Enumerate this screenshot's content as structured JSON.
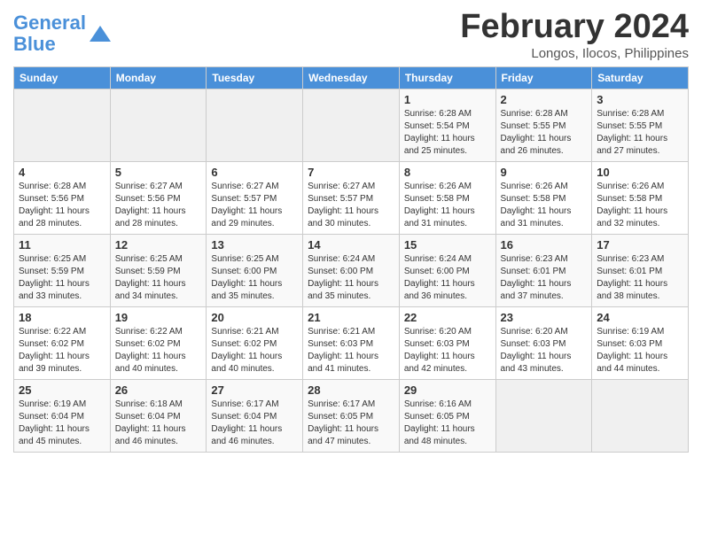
{
  "logo": {
    "line1": "General",
    "line2": "Blue"
  },
  "title": "February 2024",
  "subtitle": "Longos, Ilocos, Philippines",
  "days_of_week": [
    "Sunday",
    "Monday",
    "Tuesday",
    "Wednesday",
    "Thursday",
    "Friday",
    "Saturday"
  ],
  "weeks": [
    [
      {
        "day": "",
        "info": ""
      },
      {
        "day": "",
        "info": ""
      },
      {
        "day": "",
        "info": ""
      },
      {
        "day": "",
        "info": ""
      },
      {
        "day": "1",
        "info": "Sunrise: 6:28 AM\nSunset: 5:54 PM\nDaylight: 11 hours\nand 25 minutes."
      },
      {
        "day": "2",
        "info": "Sunrise: 6:28 AM\nSunset: 5:55 PM\nDaylight: 11 hours\nand 26 minutes."
      },
      {
        "day": "3",
        "info": "Sunrise: 6:28 AM\nSunset: 5:55 PM\nDaylight: 11 hours\nand 27 minutes."
      }
    ],
    [
      {
        "day": "4",
        "info": "Sunrise: 6:28 AM\nSunset: 5:56 PM\nDaylight: 11 hours\nand 28 minutes."
      },
      {
        "day": "5",
        "info": "Sunrise: 6:27 AM\nSunset: 5:56 PM\nDaylight: 11 hours\nand 28 minutes."
      },
      {
        "day": "6",
        "info": "Sunrise: 6:27 AM\nSunset: 5:57 PM\nDaylight: 11 hours\nand 29 minutes."
      },
      {
        "day": "7",
        "info": "Sunrise: 6:27 AM\nSunset: 5:57 PM\nDaylight: 11 hours\nand 30 minutes."
      },
      {
        "day": "8",
        "info": "Sunrise: 6:26 AM\nSunset: 5:58 PM\nDaylight: 11 hours\nand 31 minutes."
      },
      {
        "day": "9",
        "info": "Sunrise: 6:26 AM\nSunset: 5:58 PM\nDaylight: 11 hours\nand 31 minutes."
      },
      {
        "day": "10",
        "info": "Sunrise: 6:26 AM\nSunset: 5:58 PM\nDaylight: 11 hours\nand 32 minutes."
      }
    ],
    [
      {
        "day": "11",
        "info": "Sunrise: 6:25 AM\nSunset: 5:59 PM\nDaylight: 11 hours\nand 33 minutes."
      },
      {
        "day": "12",
        "info": "Sunrise: 6:25 AM\nSunset: 5:59 PM\nDaylight: 11 hours\nand 34 minutes."
      },
      {
        "day": "13",
        "info": "Sunrise: 6:25 AM\nSunset: 6:00 PM\nDaylight: 11 hours\nand 35 minutes."
      },
      {
        "day": "14",
        "info": "Sunrise: 6:24 AM\nSunset: 6:00 PM\nDaylight: 11 hours\nand 35 minutes."
      },
      {
        "day": "15",
        "info": "Sunrise: 6:24 AM\nSunset: 6:00 PM\nDaylight: 11 hours\nand 36 minutes."
      },
      {
        "day": "16",
        "info": "Sunrise: 6:23 AM\nSunset: 6:01 PM\nDaylight: 11 hours\nand 37 minutes."
      },
      {
        "day": "17",
        "info": "Sunrise: 6:23 AM\nSunset: 6:01 PM\nDaylight: 11 hours\nand 38 minutes."
      }
    ],
    [
      {
        "day": "18",
        "info": "Sunrise: 6:22 AM\nSunset: 6:02 PM\nDaylight: 11 hours\nand 39 minutes."
      },
      {
        "day": "19",
        "info": "Sunrise: 6:22 AM\nSunset: 6:02 PM\nDaylight: 11 hours\nand 40 minutes."
      },
      {
        "day": "20",
        "info": "Sunrise: 6:21 AM\nSunset: 6:02 PM\nDaylight: 11 hours\nand 40 minutes."
      },
      {
        "day": "21",
        "info": "Sunrise: 6:21 AM\nSunset: 6:03 PM\nDaylight: 11 hours\nand 41 minutes."
      },
      {
        "day": "22",
        "info": "Sunrise: 6:20 AM\nSunset: 6:03 PM\nDaylight: 11 hours\nand 42 minutes."
      },
      {
        "day": "23",
        "info": "Sunrise: 6:20 AM\nSunset: 6:03 PM\nDaylight: 11 hours\nand 43 minutes."
      },
      {
        "day": "24",
        "info": "Sunrise: 6:19 AM\nSunset: 6:03 PM\nDaylight: 11 hours\nand 44 minutes."
      }
    ],
    [
      {
        "day": "25",
        "info": "Sunrise: 6:19 AM\nSunset: 6:04 PM\nDaylight: 11 hours\nand 45 minutes."
      },
      {
        "day": "26",
        "info": "Sunrise: 6:18 AM\nSunset: 6:04 PM\nDaylight: 11 hours\nand 46 minutes."
      },
      {
        "day": "27",
        "info": "Sunrise: 6:17 AM\nSunset: 6:04 PM\nDaylight: 11 hours\nand 46 minutes."
      },
      {
        "day": "28",
        "info": "Sunrise: 6:17 AM\nSunset: 6:05 PM\nDaylight: 11 hours\nand 47 minutes."
      },
      {
        "day": "29",
        "info": "Sunrise: 6:16 AM\nSunset: 6:05 PM\nDaylight: 11 hours\nand 48 minutes."
      },
      {
        "day": "",
        "info": ""
      },
      {
        "day": "",
        "info": ""
      }
    ]
  ]
}
